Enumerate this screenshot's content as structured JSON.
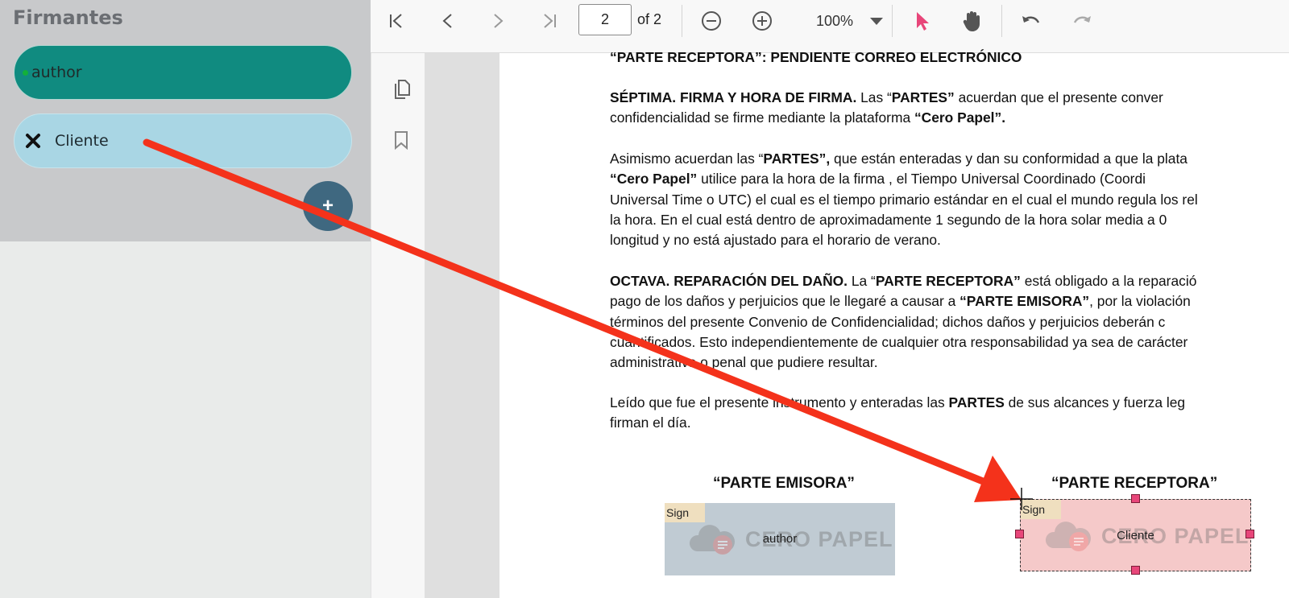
{
  "sidebar": {
    "title": "Firmantes",
    "signers": [
      {
        "label": "author"
      },
      {
        "label": "Cliente"
      }
    ],
    "add_label": "+"
  },
  "toolbar": {
    "page_current": "2",
    "page_total": "of 2",
    "zoom": "100%"
  },
  "document": {
    "lines": {
      "l0": "“PARTE RECEPTORA”: PENDIENTE CORREO ELECTRÓNICO",
      "s7_title": "SÉPTIMA. FIRMA Y HORA DE FIRMA.",
      "s7_a": "  Las “",
      "s7_b": "PARTES”",
      "s7_c": " acuerdan que el presente conver",
      "s7_d": "confidencialidad se firme mediante la plataforma ",
      "s7_e": "“Cero Papel”.",
      "p2_a": "Asimismo acuerdan las “",
      "p2_b": "PARTES”,",
      "p2_c": "  que están enteradas y dan su conformidad a que la plata",
      "p2_d": "“Cero Papel”",
      "p2_e": " utilice para la hora de la firma , el Tiempo Universal  Coordinado  (Coordi",
      "p2_f": "Universal Time o  UTC) el cual es el tiempo primario estándar en el cual el mundo regula los rel",
      "p2_g": "la hora. En el cual está dentro de aproximadamente 1 segundo de la hora solar media a   0",
      "p2_h": "longitud y no está ajustado para el horario de verano.",
      "s8_title": "OCTAVA. REPARACIÓN DEL DAÑO.",
      "s8_a": "  La “",
      "s8_b": "PARTE RECEPTORA”",
      "s8_c": " está obligado a la reparació",
      "s8_d": "pago de los daños y perjuicios que le llegaré a causar a ",
      "s8_e": "“PARTE EMISORA”",
      "s8_f": ", por la violación",
      "s8_g": "términos del presente Convenio de Confidencialidad; dichos daños y perjuicios deberán c",
      "s8_h": "cuantificados. Esto independientemente de cualquier otra responsabilidad ya sea de carácter",
      "s8_i": "administrativa o penal que pudiere resultar.",
      "p4_a": "Leído que fue el presente instrumento y enteradas las ",
      "p4_b": "PARTES",
      "p4_c": " de sus alcances y fuerza leg",
      "p4_d": "firman el día."
    },
    "party_emisora": "“PARTE EMISORA”",
    "party_receptora": "“PARTE RECEPTORA”"
  },
  "signature_fields": [
    {
      "tag": "Sign",
      "name": "author",
      "watermark": "CERO PAPEL"
    },
    {
      "tag": "Sign",
      "name": "Cliente",
      "watermark": "CERO PAPEL"
    }
  ],
  "colors": {
    "author": "#108b80",
    "client": "#a9d6e4",
    "arrow": "#f4321b",
    "selected_handle": "#e8467a"
  }
}
